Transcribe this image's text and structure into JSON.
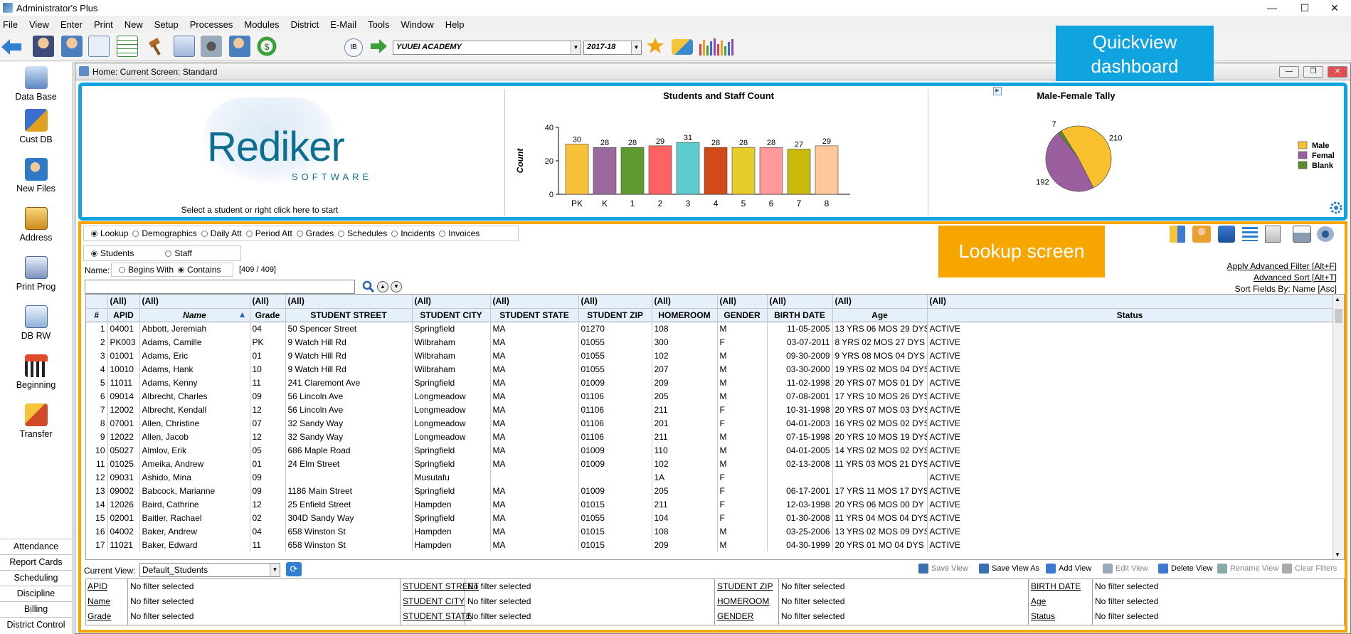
{
  "window": {
    "title": "Administrator's Plus"
  },
  "menu": [
    "File",
    "View",
    "Enter",
    "Print",
    "New",
    "Setup",
    "Processes",
    "Modules",
    "District",
    "E-Mail",
    "Tools",
    "Window",
    "Help"
  ],
  "toolbar": {
    "school": "YUUEI ACADEMY",
    "year": "2017-18"
  },
  "nav": {
    "items": [
      "Data Base",
      "Cust DB",
      "New Files",
      "Address",
      "Print Prog",
      "DB RW",
      "Beginning",
      "Transfer"
    ],
    "bottom": [
      "Attendance",
      "Report Cards",
      "Scheduling",
      "Discipline",
      "Billing",
      "District Control"
    ]
  },
  "inner": {
    "title": "Home: Current Screen: Standard"
  },
  "dashboard": {
    "logo_word": "Rediker",
    "logo_sub": "SOFTWARE",
    "start_text": "Select a student or right click here to start",
    "callout": "Quickview dashboard"
  },
  "chart_data": [
    {
      "type": "bar",
      "title": "Students and Staff Count",
      "ylabel": "Count",
      "categories": [
        "PK",
        "K",
        "1",
        "2",
        "3",
        "4",
        "5",
        "6",
        "7",
        "8"
      ],
      "values": [
        30,
        28,
        28,
        29,
        31,
        28,
        28,
        28,
        27,
        29
      ],
      "colors": [
        "#f7c23a",
        "#9b6a9c",
        "#5e9a2f",
        "#ff6262",
        "#5ccccc",
        "#d24a17",
        "#e8cc2a",
        "#ff9a9a",
        "#c8b90d",
        "#ffc89b"
      ],
      "ylim": [
        0,
        40
      ],
      "yticks": [
        "0",
        "20",
        "40"
      ]
    },
    {
      "type": "pie",
      "title": "Male-Female Tally",
      "labels": [
        "Male",
        "Female",
        "Blank"
      ],
      "legend_text": [
        "Male",
        "Femal",
        "Blank"
      ],
      "values": [
        210,
        192,
        7
      ],
      "value_labels": [
        "210",
        "192",
        "7"
      ],
      "colors": [
        "#fbc02d",
        "#9b5e9e",
        "#5b8a2a"
      ],
      "legend": "right"
    }
  ],
  "lookup": {
    "callout": "Lookup screen",
    "tabs": [
      "Lookup",
      "Demographics",
      "Daily Att",
      "Period Att",
      "Grades",
      "Schedules",
      "Incidents",
      "Invoices"
    ],
    "who": [
      "Students",
      "Staff"
    ],
    "name_label": "Name:",
    "name_modes": [
      "Begins With",
      "Contains"
    ],
    "count": "[409 / 409]",
    "apply_filter": "Apply Advanced Filter [Alt+F]",
    "adv_sort": "Advanced Sort [Alt+T]",
    "sort_by": "Sort Fields By: Name [Asc]",
    "filter_all": "(All)",
    "columns": [
      "#",
      "APID",
      "Name",
      "Grade",
      "STUDENT STREET",
      "STUDENT CITY",
      "STUDENT STATE",
      "STUDENT ZIP",
      "HOMEROOM",
      "GENDER",
      "BIRTH DATE",
      "Age",
      "Status"
    ],
    "rows": [
      [
        "1",
        "04001",
        "Abbott, Jeremiah",
        "04",
        "50 Spencer Street",
        "Springfield",
        "MA",
        "01270",
        "108",
        "M",
        "11-05-2005",
        "13 YRS 06 MOS 29 DYS",
        "ACTIVE"
      ],
      [
        "2",
        "PK003",
        "Adams, Camille",
        "PK",
        "9 Watch Hill Rd",
        "Wilbraham",
        "MA",
        "01055",
        "300",
        "F",
        "03-07-2011",
        "8 YRS 02 MOS 27 DYS",
        "ACTIVE"
      ],
      [
        "3",
        "01001",
        "Adams, Eric",
        "01",
        "9 Watch Hill Rd",
        "Wilbraham",
        "MA",
        "01055",
        "102",
        "M",
        "09-30-2009",
        "9 YRS 08 MOS 04 DYS",
        "ACTIVE"
      ],
      [
        "4",
        "10010",
        "Adams, Hank",
        "10",
        "9 Watch Hill Rd",
        "Wilbraham",
        "MA",
        "01055",
        "207",
        "M",
        "03-30-2000",
        "19 YRS 02 MOS 04 DYS",
        "ACTIVE"
      ],
      [
        "5",
        "11011",
        "Adams, Kenny",
        "11",
        "241 Claremont Ave",
        "Springfield",
        "MA",
        "01009",
        "209",
        "M",
        "11-02-1998",
        "20 YRS 07 MOS 01 DY",
        "ACTIVE"
      ],
      [
        "6",
        "09014",
        "Albrecht, Charles",
        "09",
        "56 Lincoln Ave",
        "Longmeadow",
        "MA",
        "01106",
        "205",
        "M",
        "07-08-2001",
        "17 YRS 10 MOS 26 DYS",
        "ACTIVE"
      ],
      [
        "7",
        "12002",
        "Albrecht, Kendall",
        "12",
        "56 Lincoln Ave",
        "Longmeadow",
        "MA",
        "01106",
        "211",
        "F",
        "10-31-1998",
        "20 YRS 07 MOS 03 DYS",
        "ACTIVE"
      ],
      [
        "8",
        "07001",
        "Allen, Christine",
        "07",
        "32 Sandy Way",
        "Longmeadow",
        "MA",
        "01106",
        "201",
        "F",
        "04-01-2003",
        "16 YRS 02 MOS 02 DYS",
        "ACTIVE"
      ],
      [
        "9",
        "12022",
        "Allen, Jacob",
        "12",
        "32 Sandy Way",
        "Longmeadow",
        "MA",
        "01106",
        "211",
        "M",
        "07-15-1998",
        "20 YRS 10 MOS 19 DYS",
        "ACTIVE"
      ],
      [
        "10",
        "05027",
        "Almlov, Erik",
        "05",
        "686 Maple Road",
        "Springfield",
        "MA",
        "01009",
        "110",
        "M",
        "04-01-2005",
        "14 YRS 02 MOS 02 DYS",
        "ACTIVE"
      ],
      [
        "11",
        "01025",
        "Ameika, Andrew",
        "01",
        "24 Elm Street",
        "Springfield",
        "MA",
        "01009",
        "102",
        "M",
        "02-13-2008",
        "11 YRS 03 MOS 21 DYS",
        "ACTIVE"
      ],
      [
        "12",
        "09031",
        "Ashido, Mina",
        "09",
        "",
        "Musutafu",
        "",
        "",
        "1A",
        "F",
        "",
        "",
        "ACTIVE"
      ],
      [
        "13",
        "09002",
        "Babcock, Marianne",
        "09",
        "1186 Main Street",
        "Springfield",
        "MA",
        "01009",
        "205",
        "F",
        "06-17-2001",
        "17 YRS 11 MOS 17 DYS",
        "ACTIVE"
      ],
      [
        "14",
        "12026",
        "Baird, Cathrine",
        "12",
        "25 Enfield Street",
        "Hampden",
        "MA",
        "01015",
        "211",
        "F",
        "12-03-1998",
        "20 YRS 06 MOS 00 DY",
        "ACTIVE"
      ],
      [
        "15",
        "02001",
        "Baitler, Rachael",
        "02",
        "304D Sandy Way",
        "Springfield",
        "MA",
        "01055",
        "104",
        "F",
        "01-30-2008",
        "11 YRS 04 MOS 04 DYS",
        "ACTIVE"
      ],
      [
        "16",
        "04002",
        "Baker, Andrew",
        "04",
        "658 Winston St",
        "Hampden",
        "MA",
        "01015",
        "108",
        "M",
        "03-25-2006",
        "13 YRS 02 MOS 09 DYS",
        "ACTIVE"
      ],
      [
        "17",
        "11021",
        "Baker, Edward",
        "11",
        "658 Winston St",
        "Hampden",
        "MA",
        "01015",
        "209",
        "M",
        "04-30-1999",
        "20 YRS 01 MO 04 DYS",
        "ACTIVE"
      ]
    ],
    "current_view_label": "Current View:",
    "current_view": "Default_Students",
    "view_buttons": [
      "Save View",
      "Save View As",
      "Add View",
      "Edit View",
      "Delete View",
      "Rename View",
      "Clear Filters"
    ],
    "filters": [
      {
        "name": "APID",
        "value": "No filter selected"
      },
      {
        "name": "Name",
        "value": "No filter selected"
      },
      {
        "name": "Grade",
        "value": "No filter selected"
      },
      {
        "name": "STUDENT STREET",
        "value": "No filter selected"
      },
      {
        "name": "STUDENT CITY",
        "value": "No filter selected"
      },
      {
        "name": "STUDENT STATE",
        "value": "No filter selected"
      },
      {
        "name": "STUDENT ZIP",
        "value": "No filter selected"
      },
      {
        "name": "HOMEROOM",
        "value": "No filter selected"
      },
      {
        "name": "GENDER",
        "value": "No filter selected"
      },
      {
        "name": "BIRTH DATE",
        "value": "No filter selected"
      },
      {
        "name": "Age",
        "value": "No filter selected"
      },
      {
        "name": "Status",
        "value": "No filter selected"
      }
    ]
  }
}
